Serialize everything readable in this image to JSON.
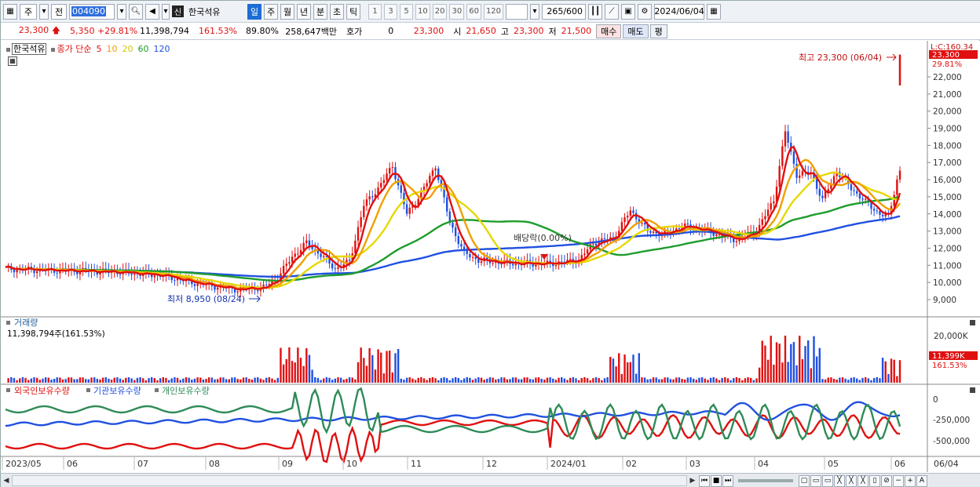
{
  "toolbar": {
    "market_label": "주",
    "prev_label": "전",
    "stock_code": "004090",
    "badge": "신",
    "stock_name": "한국석유",
    "periods": [
      "일",
      "주",
      "월",
      "년",
      "분",
      "초",
      "틱"
    ],
    "active_period": "일",
    "intervals": [
      "1",
      "3",
      "5",
      "10",
      "20",
      "30",
      "60",
      "120"
    ],
    "count": "265",
    "count_total": "/600",
    "date": "2024/06/04"
  },
  "quote": {
    "price": "23,300",
    "change": "5,350",
    "change_pct": "+29.81%",
    "volume": "11,398,794",
    "volume_ratio": "161.53%",
    "rate": "89.80%",
    "amount": "258,647백만",
    "hoga_label": "호가",
    "hoga_value": "0",
    "close_value": "23,300",
    "open_label": "시",
    "open_value": "21,650",
    "high_label": "고",
    "high_value": "23,300",
    "low_label": "저",
    "low_value": "21,500",
    "buy_label": "매수",
    "sell_label": "매도",
    "eval_label": "평"
  },
  "price_pane": {
    "legend_name": "한국석유",
    "legend_ma_label": "종가 단순",
    "ma_periods": [
      "5",
      "10",
      "20",
      "60",
      "120"
    ],
    "ma_colors": [
      "#e01010",
      "#f0a000",
      "#e6d800",
      "#1e9c2c",
      "#2050e0"
    ],
    "high_annotation": "최고 23,300 (06/04)",
    "low_annotation": "최저 8,950 (08/24)",
    "dividend_annotation": "배당락(0.00%)",
    "y_ticks": [
      "22,000",
      "21,000",
      "20,000",
      "19,000",
      "18,000",
      "17,000",
      "16,000",
      "15,000",
      "14,000",
      "13,000",
      "12,000",
      "11,000",
      "10,000",
      "9,000"
    ],
    "axis_top_label": "L:C:160.34",
    "current_price_tag": "23,300",
    "current_pct_tag": "29.81%"
  },
  "volume_pane": {
    "title": "거래량",
    "value_text": "11,398,794주(161.53%)",
    "y_tick": "20,000K",
    "current_tag": "11,399K",
    "current_pct_tag": "161.53%"
  },
  "holding_pane": {
    "series": [
      "외국인보유수량",
      "기관보유수량",
      "개인보유수량"
    ],
    "colors": [
      "#e01010",
      "#2050e0",
      "#2e8b57"
    ],
    "y_ticks": [
      "0",
      "-250,000",
      "-500,000"
    ]
  },
  "x_axis": {
    "labels": [
      "2023/05",
      "06",
      "07",
      "08",
      "09",
      "10",
      "11",
      "12",
      "2024/01",
      "02",
      "03",
      "04",
      "05",
      "06"
    ],
    "right_label": "06/04"
  }
}
